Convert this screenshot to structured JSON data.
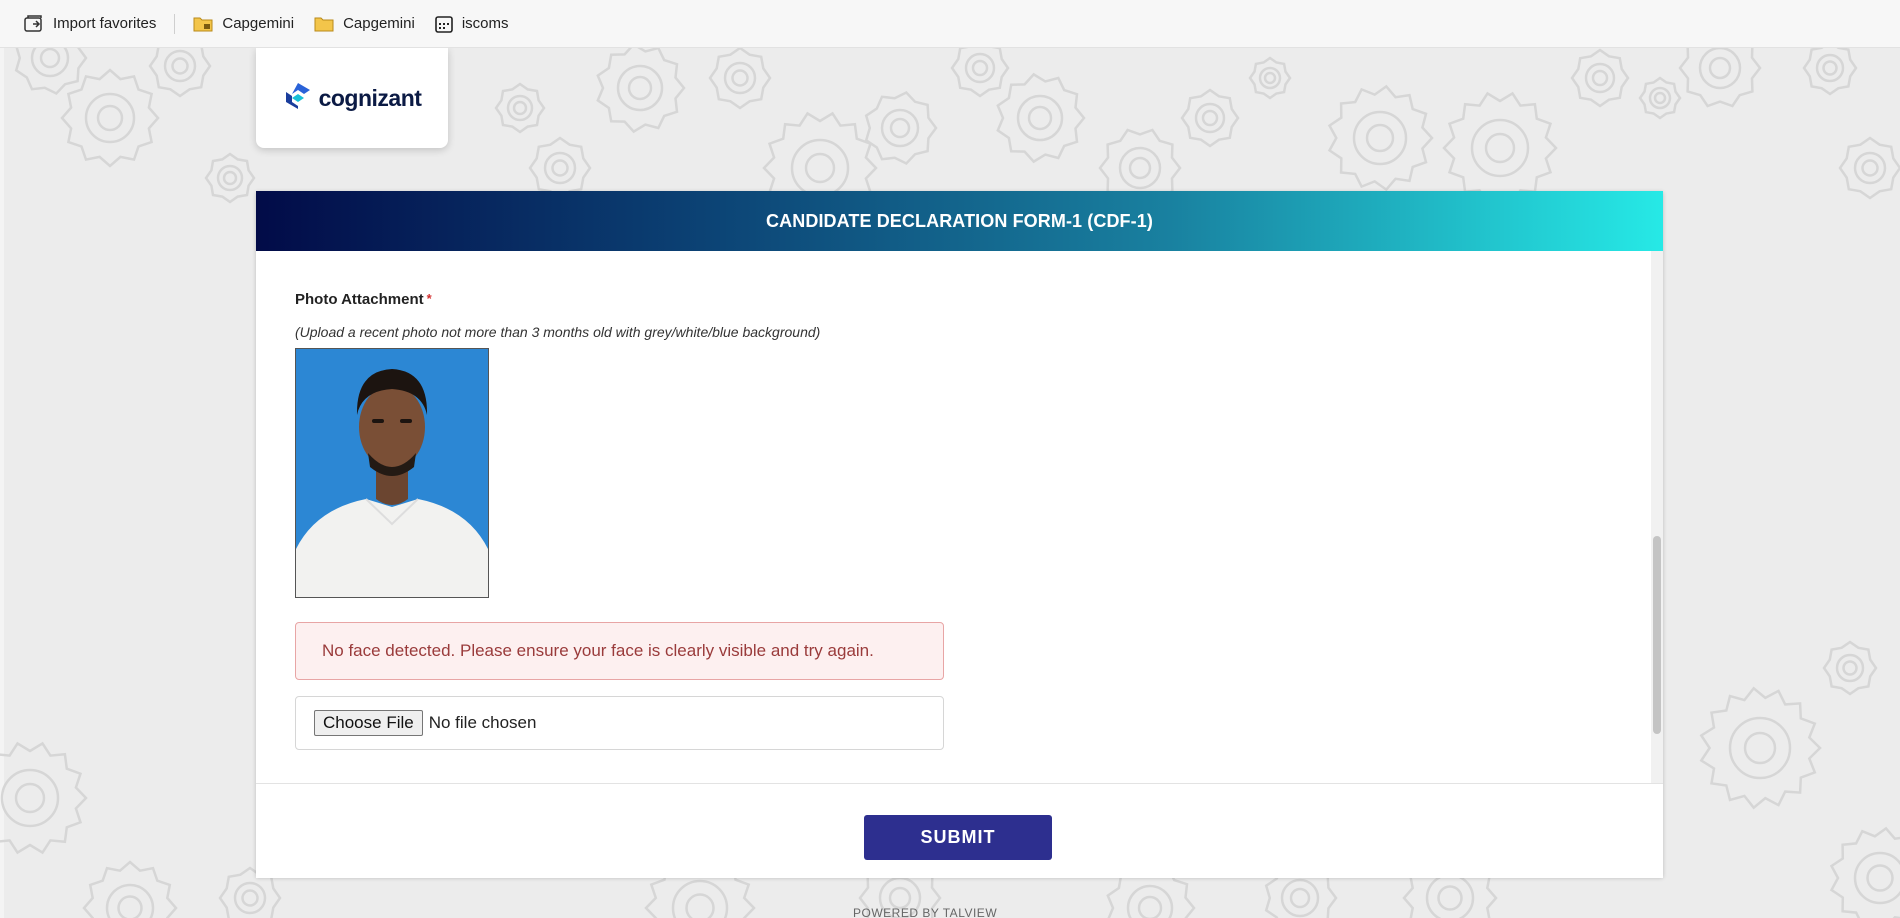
{
  "bookmarks": {
    "items": [
      {
        "label": "Import favorites",
        "icon": "import-favorites-icon"
      },
      {
        "label": "Capgemini",
        "icon": "folder-icon"
      },
      {
        "label": "Capgemini",
        "icon": "folder-icon"
      },
      {
        "label": "iscoms",
        "icon": "calendar-icon"
      }
    ]
  },
  "logo": {
    "text": "cognizant"
  },
  "form": {
    "title": "CANDIDATE DECLARATION FORM-1 (CDF-1)",
    "photo_label": "Photo Attachment",
    "required_mark": "*",
    "photo_hint": "(Upload a recent photo not more than 3 months old with grey/white/blue background)",
    "error_message": "No face detected. Please ensure your face is clearly visible and try again.",
    "choose_file_label": "Choose File",
    "file_status": "No file chosen",
    "submit_label": "SUBMIT"
  },
  "footer": {
    "powered_by": "POWERED BY TALVIEW"
  },
  "colors": {
    "header_gradient_start": "#020b48",
    "header_gradient_end": "#26e9e6",
    "submit_bg": "#2d2f8f",
    "error_text": "#9a3b3b",
    "error_bg": "#fdf0f0",
    "required": "#d32f2f"
  }
}
